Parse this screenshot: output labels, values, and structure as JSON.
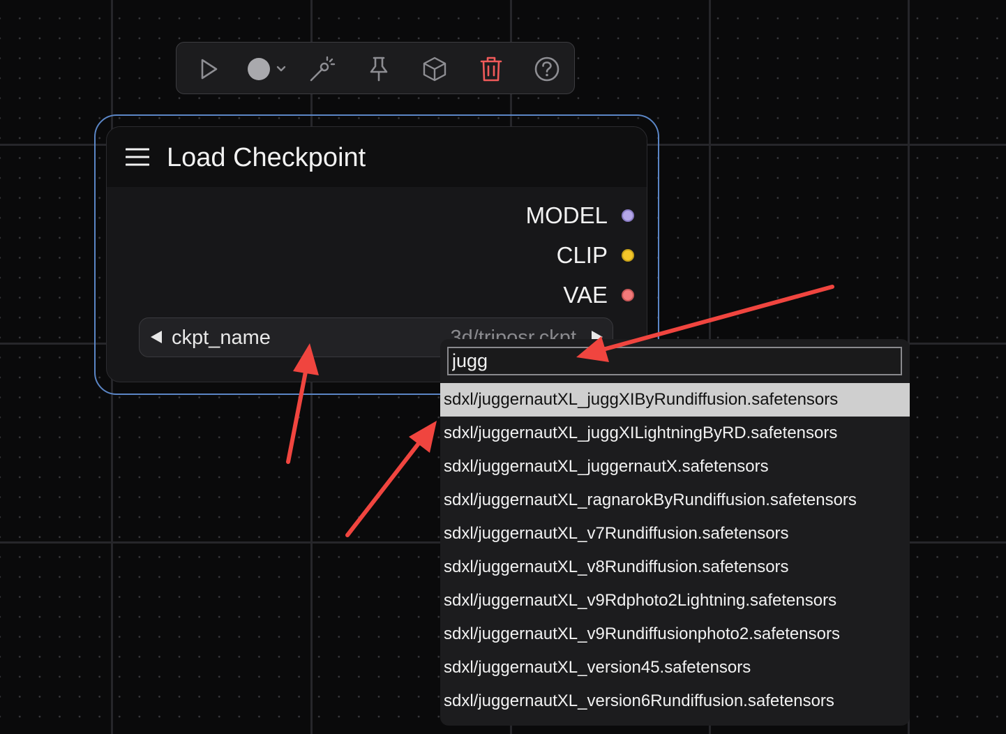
{
  "colors": {
    "accent_selection": "#5b86c6",
    "model_dot": "#b4a6e8",
    "clip_dot": "#f3c62a",
    "vae_dot": "#f27a7a",
    "delete_icon": "#f05a5a",
    "annotation_arrow": "#f0453f"
  },
  "toolbar": {
    "buttons": [
      {
        "icon": "play-icon"
      },
      {
        "icon": "color-dot-dropdown-icon"
      },
      {
        "icon": "bypass-wand-icon"
      },
      {
        "icon": "pin-icon"
      },
      {
        "icon": "cube-icon"
      },
      {
        "icon": "trash-icon"
      },
      {
        "icon": "help-icon"
      }
    ]
  },
  "node": {
    "title": "Load Checkpoint",
    "outputs": [
      {
        "label": "MODEL"
      },
      {
        "label": "CLIP"
      },
      {
        "label": "VAE"
      }
    ],
    "widget": {
      "label": "ckpt_name",
      "value": "3d/triposr.ckpt"
    }
  },
  "dropdown": {
    "search_value": "jugg",
    "options": [
      "sdxl/juggernautXL_juggXIByRundiffusion.safetensors",
      "sdxl/juggernautXL_juggXILightningByRD.safetensors",
      "sdxl/juggernautXL_juggernautX.safetensors",
      "sdxl/juggernautXL_ragnarokByRundiffusion.safetensors",
      "sdxl/juggernautXL_v7Rundiffusion.safetensors",
      "sdxl/juggernautXL_v8Rundiffusion.safetensors",
      "sdxl/juggernautXL_v9Rdphoto2Lightning.safetensors",
      "sdxl/juggernautXL_v9Rundiffusionphoto2.safetensors",
      "sdxl/juggernautXL_version45.safetensors",
      "sdxl/juggernautXL_version6Rundiffusion.safetensors"
    ],
    "selected_index": 0
  }
}
